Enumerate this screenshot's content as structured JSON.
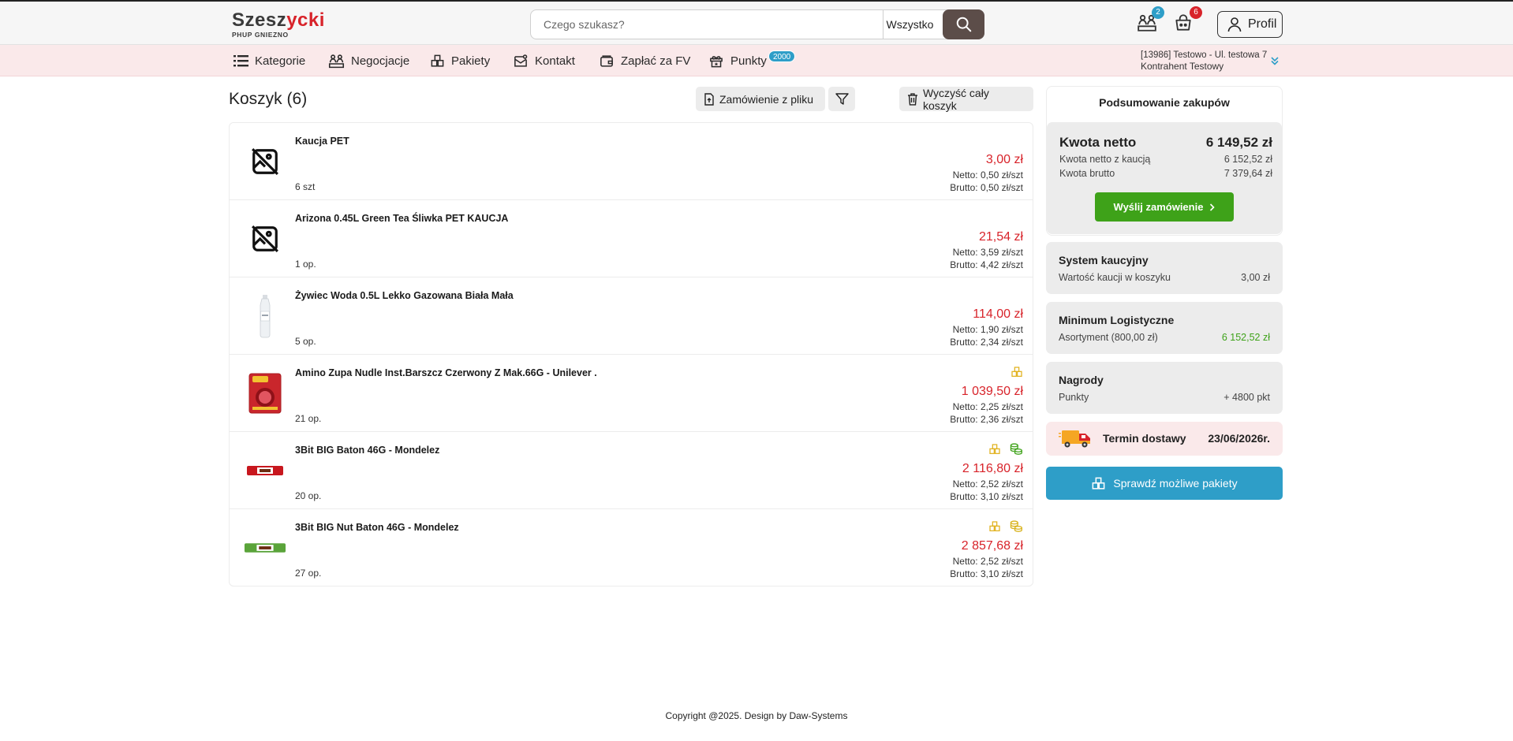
{
  "header": {
    "logo_main_a": "Szesz",
    "logo_main_b": "ycki",
    "logo_sub": "PHUP GNIEZNO",
    "search_placeholder": "Czego szukasz?",
    "search_category": "Wszystko",
    "negotiations_badge": "2",
    "cart_badge": "6",
    "profile_label": "Profil"
  },
  "nav": {
    "items": [
      {
        "label": "Kategorie",
        "icon": "list-icon"
      },
      {
        "label": "Negocjacje",
        "icon": "negotiation-icon"
      },
      {
        "label": "Pakiety",
        "icon": "package-icon"
      },
      {
        "label": "Kontakt",
        "icon": "mail-icon"
      },
      {
        "label": "Zapłać za FV",
        "icon": "wallet-icon"
      },
      {
        "label": "Punkty",
        "icon": "points-gift-icon"
      }
    ],
    "points_badge": "2000",
    "account_line1": "[13986] Testowo - Ul. testowa 7",
    "account_line2": "Kontrahent Testowy"
  },
  "cart": {
    "title": "Koszyk (6)",
    "order_from_file": "Zamówienie z pliku",
    "clear_cart": "Wyczyść cały koszyk",
    "items": [
      {
        "name": "Kaucja PET",
        "qty": "6 szt",
        "price": "3,00 zł",
        "netto": "Netto: 0,50 zł/szt",
        "brutto": "Brutto: 0,50 zł/szt",
        "thumb": "no-image-icon",
        "badges": []
      },
      {
        "name": "Arizona 0.45L Green Tea Śliwka PET KAUCJA",
        "qty": "1 op.",
        "price": "21,54 zł",
        "netto": "Netto: 3,59 zł/szt",
        "brutto": "Brutto: 4,42 zł/szt",
        "thumb": "no-image-icon",
        "badges": []
      },
      {
        "name": "Żywiec Woda 0.5L Lekko Gazowana Biała Mała",
        "qty": "5 op.",
        "price": "114,00 zł",
        "netto": "Netto: 1,90 zł/szt",
        "brutto": "Brutto: 2,34 zł/szt",
        "thumb": "bottle",
        "badges": []
      },
      {
        "name": "Amino Zupa Nudle Inst.Barszcz Czerwony Z Mak.66G - Unilever .",
        "qty": "21 op.",
        "price": "1 039,50 zł",
        "netto": "Netto: 2,25 zł/szt",
        "brutto": "Brutto: 2,36 zł/szt",
        "thumb": "soup",
        "badges": [
          "package-icon"
        ]
      },
      {
        "name": "3Bit BIG Baton 46G - Mondelez",
        "qty": "20 op.",
        "price": "2 116,80 zł",
        "netto": "Netto: 2,52 zł/szt",
        "brutto": "Brutto: 3,10 zł/szt",
        "thumb": "bar-red",
        "badges": [
          "package-icon",
          "coins-icon-green"
        ]
      },
      {
        "name": "3Bit BIG Nut Baton 46G - Mondelez",
        "qty": "27 op.",
        "price": "2 857,68 zł",
        "netto": "Netto: 2,52 zł/szt",
        "brutto": "Brutto: 3,10 zł/szt",
        "thumb": "bar-green",
        "badges": [
          "package-icon",
          "coins-icon-yellow"
        ]
      }
    ]
  },
  "summary": {
    "header": "Podsumowanie zakupów",
    "net_label": "Kwota netto",
    "net_value": "6 149,52 zł",
    "net_deposit_label": "Kwota netto z kaucją",
    "net_deposit_value": "6 152,52 zł",
    "gross_label": "Kwota brutto",
    "gross_value": "7 379,64 zł",
    "send_order": "Wyślij zamówienie",
    "deposit_title": "System kaucyjny",
    "deposit_label": "Wartość kaucji w koszyku",
    "deposit_value": "3,00 zł",
    "logistics_title": "Minimum Logistyczne",
    "logistics_label": "Asortyment (800,00 zł)",
    "logistics_value": "6 152,52 zł",
    "rewards_title": "Nagrody",
    "rewards_label": "Punkty",
    "rewards_value": "+ 4800 pkt",
    "delivery_label": "Termin dostawy",
    "delivery_value": "23/06/2026r.",
    "check_packages": "Sprawdź możliwe pakiety"
  },
  "colors": {
    "brand_red": "#d8232a",
    "accent_blue": "#2e9ec8",
    "send_green": "#3ea219",
    "nav_pink": "#fae9ea"
  },
  "footer": {
    "text": "Copyright @2025. Design by Daw-Systems"
  }
}
